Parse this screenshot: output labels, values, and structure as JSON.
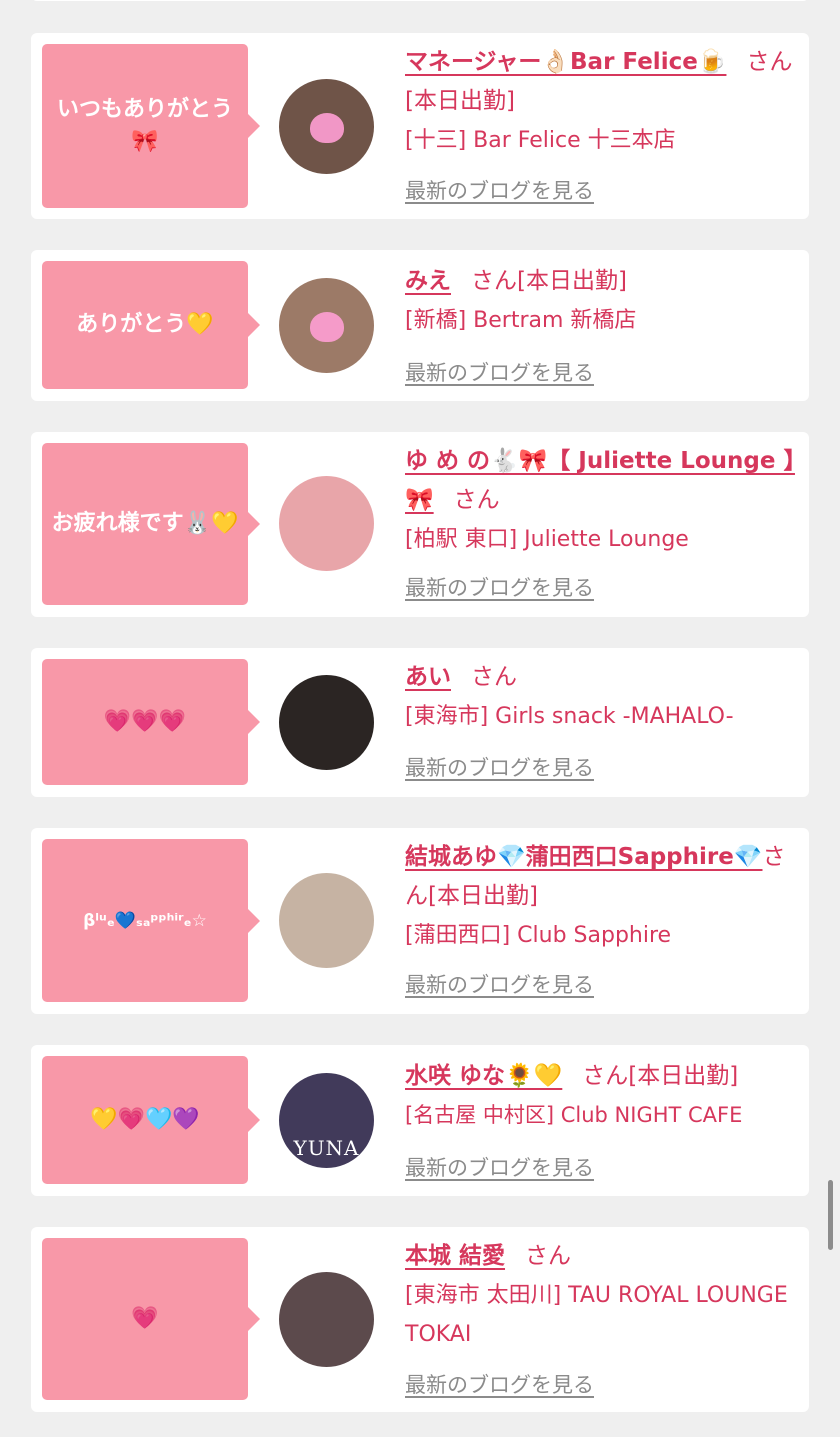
{
  "cards": [
    {
      "bubble": "いつもありがとう🎀",
      "name": "マネージャー👌🏻Bar Felice🍺",
      "san": "さん",
      "status": "[本日出勤]",
      "shop": "[十三] Bar Felice 十三本店",
      "blog": "最新のブログを見る",
      "avatar_bg": "#6f5448"
    },
    {
      "bubble": "ありがとう💛",
      "name": "みえ",
      "san": "さん",
      "status": "[本日出勤]",
      "shop": "[新橋] Bertram 新橋店",
      "blog": "最新のブログを見る",
      "avatar_bg": "#9c7a67"
    },
    {
      "bubble": "お疲れ様です🐰💛",
      "name": "ゆ め の🐇🎀【 Juliette Lounge 】🎀",
      "san": "さん",
      "status": "",
      "shop": "[柏駅 東口] Juliette Lounge",
      "blog": "最新のブログを見る",
      "avatar_bg": "#e8a5a9"
    },
    {
      "bubble": "💗💗💗",
      "name": "あい",
      "san": "さん",
      "status": "",
      "shop": "[東海市] Girls snack -MAHALO-",
      "blog": "最新のブログを見る",
      "avatar_bg": "#2b2523"
    },
    {
      "bubble": "βˡᵘₑ💙ₛₐᵖᵖʰⁱʳₑ☆",
      "name": "結城あゆ💎蒲田西口Sapphire💎",
      "san": "さん",
      "status": "[本日出勤]",
      "shop": "[蒲田西口] Club Sapphire",
      "blog": "最新のブログを見る",
      "avatar_bg": "#c6b3a3"
    },
    {
      "bubble": "💛💗🩵💜",
      "name": "水咲 ゆな🌻💛",
      "san": "さん",
      "status": "[本日出勤]",
      "shop": "[名古屋 中村区] Club NIGHT CAFE",
      "blog": "最新のブログを見る",
      "avatar_bg": "#413a5a",
      "avatar_text": "YUNA"
    },
    {
      "bubble": "💗",
      "name": "本城 結愛",
      "san": "さん",
      "status": "",
      "shop": "[東海市 太田川] TAU ROYAL LOUNGE TOKAI",
      "blog": "最新のブログを見る",
      "avatar_bg": "#5c4a4c"
    }
  ]
}
